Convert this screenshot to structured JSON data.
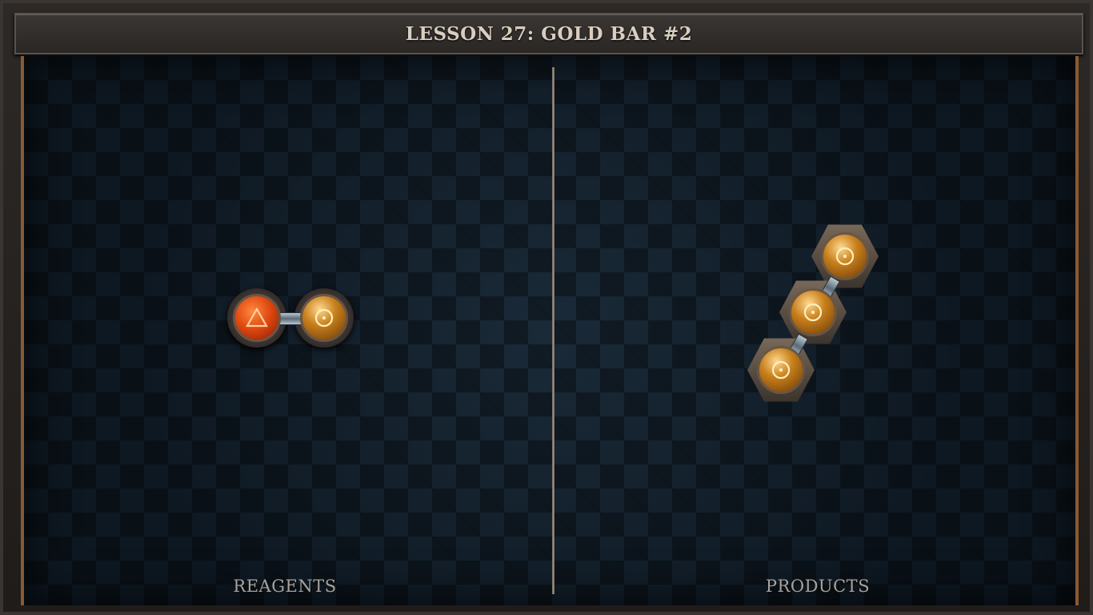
{
  "title": "LESSON 27: GOLD BAR #2",
  "panels": {
    "left_label": "REAGENTS",
    "right_label": "PRODUCTS"
  },
  "reagent": {
    "atoms": [
      {
        "element": "fire",
        "icon": "fire-triangle-icon",
        "color": "#e04a10"
      },
      {
        "element": "gold",
        "icon": "gold-sun-icon",
        "color": "#c8801c"
      }
    ],
    "bonds": 1
  },
  "product": {
    "atoms": [
      {
        "element": "gold",
        "icon": "gold-sun-icon",
        "color": "#c8801c"
      },
      {
        "element": "gold",
        "icon": "gold-sun-icon",
        "color": "#c8801c"
      },
      {
        "element": "gold",
        "icon": "gold-sun-icon",
        "color": "#c8801c"
      }
    ],
    "bonds": 2
  },
  "colors": {
    "board": "#101b26",
    "frame_accent": "#8a5a32",
    "label_text": "#a8a29a",
    "title_text": "#d8cdbf"
  }
}
